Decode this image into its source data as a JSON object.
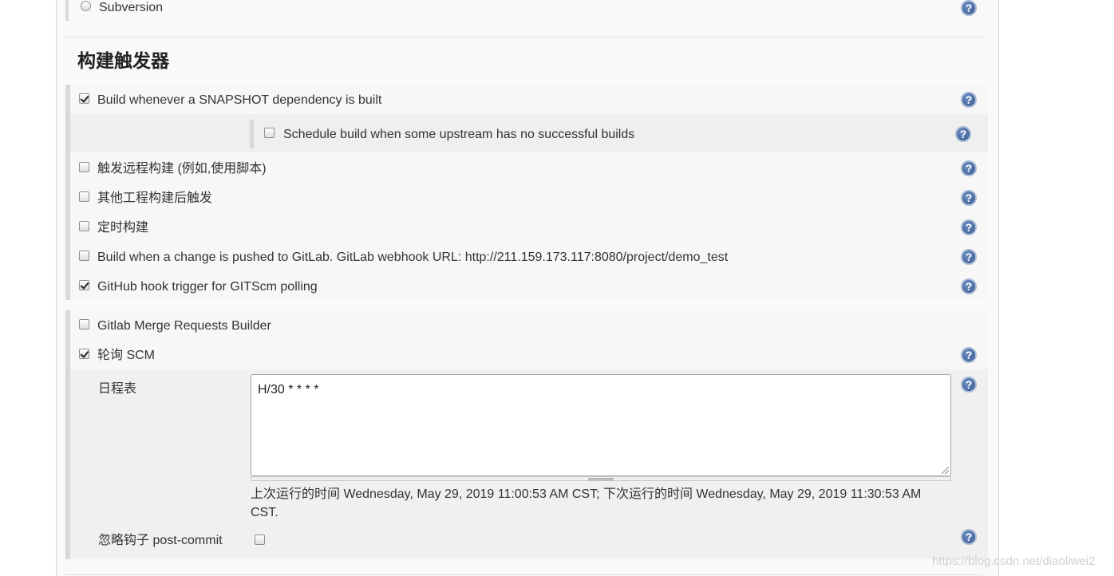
{
  "scm_option": {
    "label": "Subversion"
  },
  "section": {
    "title": "构建触发器"
  },
  "triggers": [
    {
      "label": "Build whenever a SNAPSHOT dependency is built",
      "checked": true
    },
    {
      "label": "Schedule build when some upstream has no successful builds",
      "checked": false
    },
    {
      "label": "触发远程构建 (例如,使用脚本)",
      "checked": false
    },
    {
      "label": "其他工程构建后触发",
      "checked": false
    },
    {
      "label": "定时构建",
      "checked": false
    },
    {
      "label": "Build when a change is pushed to GitLab. GitLab webhook URL: http://211.159.173.117:8080/project/demo_test",
      "checked": false
    },
    {
      "label": "GitHub hook trigger for GITScm polling",
      "checked": true
    },
    {
      "label": "Gitlab Merge Requests Builder",
      "checked": false
    },
    {
      "label": "轮询 SCM",
      "checked": true
    }
  ],
  "poll_scm": {
    "schedule_label": "日程表",
    "schedule_value": "H/30 * * * *",
    "run_info_line1": "上次运行的时间 Wednesday, May 29, 2019 11:00:53 AM CST; 下次运行的时间 Wednesday, May 29, 2019 11:30:53 AM",
    "run_info_line2": "CST.",
    "ignore_hooks_label": "忽略钩子 post-commit",
    "ignore_hooks_checked": false
  },
  "help_symbol": "?",
  "icons": {
    "help": "help-icon"
  },
  "watermark": "https://blog.csdn.net/diaoliwei2",
  "colors": {
    "help_icon": "#36588f",
    "panel_bg": "#f9f9f9",
    "nested_bg": "#f0f0f0"
  }
}
